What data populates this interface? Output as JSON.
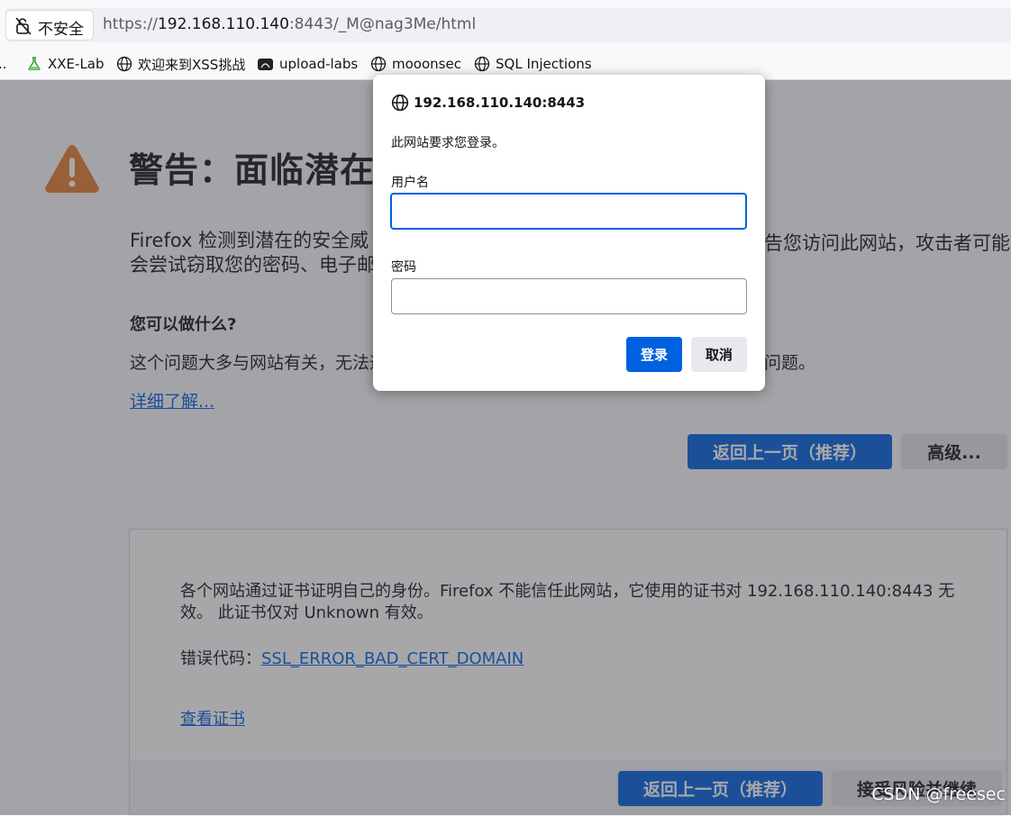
{
  "urlbar": {
    "security_label": "不安全",
    "url_prefix": "https://",
    "url_host": "192.168.110.140",
    "url_rest": ":8443/_M@nag3Me/html"
  },
  "bookmarks": {
    "overflow": "..",
    "items": [
      "XXE-Lab",
      "欢迎来到XSS挑战",
      "upload-labs",
      "mooonsec",
      "SQL Injections"
    ]
  },
  "page": {
    "title": "警告：面临潜在",
    "desc_line1_left": "Firefox 检测到潜在的安全威",
    "desc_line1_right": "告您访问此网站，攻击者可能",
    "desc_line2_left": "会尝试窃取您的密码、电子邮",
    "what_heading": "您可以做什么?",
    "what_desc_left": "这个问题大多与网站有关，无法通",
    "what_desc_right": "问题。",
    "learn_more": "详细了解...",
    "back_button": "返回上一页（推荐）",
    "advanced_button": "高级..."
  },
  "advanced": {
    "text": "各个网站通过证书证明自己的身份。Firefox 不能信任此网站，它使用的证书对 192.168.110.140:8443 无效。 此证书仅对 Unknown 有效。",
    "error_label": "错误代码：",
    "error_code": "SSL_ERROR_BAD_CERT_DOMAIN",
    "view_cert": "查看证书",
    "back_button": "返回上一页（推荐）",
    "accept_button": "接受风险并继续"
  },
  "dialog": {
    "host": "192.168.110.140:8443",
    "message": "此网站要求您登录。",
    "username_label": "用户名",
    "username_value": "",
    "password_label": "密码",
    "password_value": "",
    "login_button": "登录",
    "cancel_button": "取消"
  },
  "watermark": "CSDN @freesec",
  "colors": {
    "accent": "#0061e0",
    "warning": "#b8711f"
  }
}
